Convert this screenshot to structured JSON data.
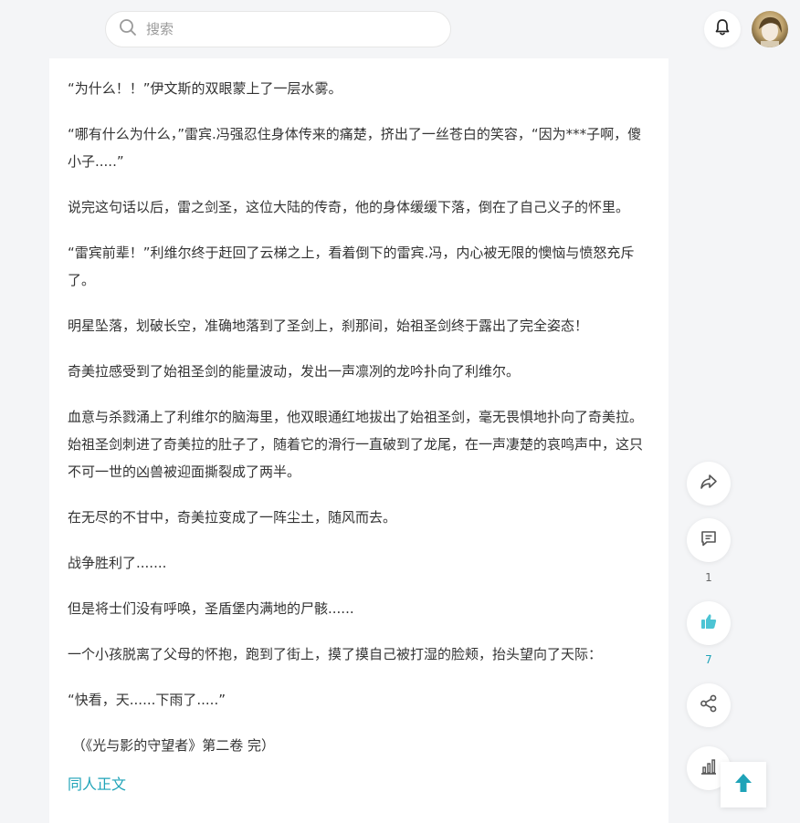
{
  "header": {
    "search_placeholder": "搜索"
  },
  "article": {
    "paragraphs": [
      "“为什么！！”伊文斯的双眼蒙上了一层水雾。",
      "“哪有什么为什么，”雷宾.冯强忍住身体传来的痛楚，挤出了一丝苍白的笑容，“因为***子啊，傻小子.....”",
      "说完这句话以后，雷之剑圣，这位大陆的传奇，他的身体缓缓下落，倒在了自己义子的怀里。",
      "“雷宾前辈！”利维尔终于赶回了云梯之上，看着倒下的雷宾.冯，内心被无限的懊恼与愤怒充斥了。",
      "明星坠落，划破长空，准确地落到了圣剑上，刹那间，始祖圣剑终于露出了完全姿态！",
      "奇美拉感受到了始祖圣剑的能量波动，发出一声凛冽的龙吟扑向了利维尔。",
      "血意与杀戮涌上了利维尔的脑海里，他双眼通红地拔出了始祖圣剑，毫无畏惧地扑向了奇美拉。始祖圣剑刺进了奇美拉的肚子了，随着它的滑行一直破到了龙尾，在一声凄楚的哀鸣声中，这只不可一世的凶兽被迎面撕裂成了两半。",
      "在无尽的不甘中，奇美拉变成了一阵尘土，随风而去。",
      "战争胜利了.......",
      "但是将士们没有呼唤，圣盾堡内满地的尸骸......",
      "一个小孩脱离了父母的怀抱，跑到了街上，摸了摸自己被打湿的脸颊，抬头望向了天际：",
      "“快看，天......下雨了.....”",
      " （《光与影的守望者》第二卷 完）"
    ],
    "tag_link": "同人正文"
  },
  "sidebar": {
    "comment_count": "1",
    "like_count": "7"
  },
  "colors": {
    "accent": "#1fa3b8",
    "like_icon": "#4cc4d4",
    "background": "#f4f5f7"
  },
  "icons": [
    "search-icon",
    "bell-icon",
    "share-arrow-icon",
    "comment-icon",
    "thumbs-up-icon",
    "share-network-icon",
    "bar-chart-icon",
    "arrow-up-icon"
  ]
}
